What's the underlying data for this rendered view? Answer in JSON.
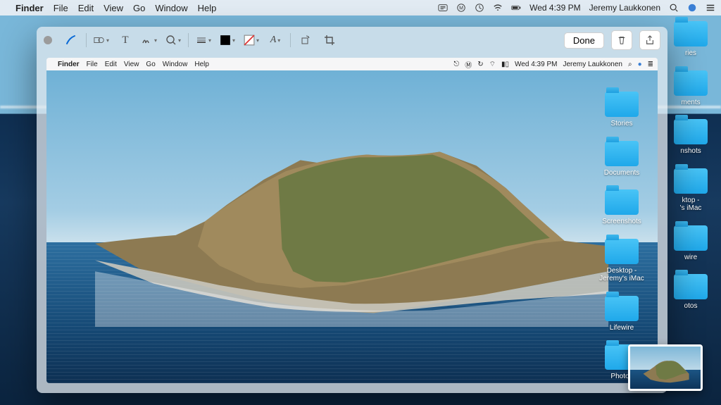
{
  "menubar": {
    "app": "Finder",
    "items": [
      "File",
      "Edit",
      "View",
      "Go",
      "Window",
      "Help"
    ],
    "clock": "Wed 4:39 PM",
    "user": "Jeremy Laukkonen"
  },
  "desktop_folders_outer": [
    {
      "label": "ries"
    },
    {
      "label": "ments"
    },
    {
      "label": "nshots"
    },
    {
      "label": "ktop -\n's iMac"
    },
    {
      "label": "wire"
    },
    {
      "label": "otos"
    }
  ],
  "editor": {
    "done_label": "Done",
    "tools": [
      "close",
      "pen",
      "shapes",
      "text",
      "sign",
      "magnifier",
      "line-style",
      "stroke-color",
      "fill-color",
      "text-style",
      "rotate",
      "crop"
    ]
  },
  "inner_menubar": {
    "app": "Finder",
    "items": [
      "File",
      "Edit",
      "View",
      "Go",
      "Window",
      "Help"
    ],
    "clock": "Wed 4:39 PM",
    "user": "Jeremy Laukkonen"
  },
  "desktop_folders_inner": [
    {
      "label": "Stories"
    },
    {
      "label": "Documents"
    },
    {
      "label": "Screenshots"
    },
    {
      "label": "Desktop -\nJeremy's iMac"
    },
    {
      "label": "Lifewire"
    },
    {
      "label": "Photos"
    }
  ],
  "colors": {
    "folder": "#26a9e5",
    "accent": "#007aff"
  }
}
